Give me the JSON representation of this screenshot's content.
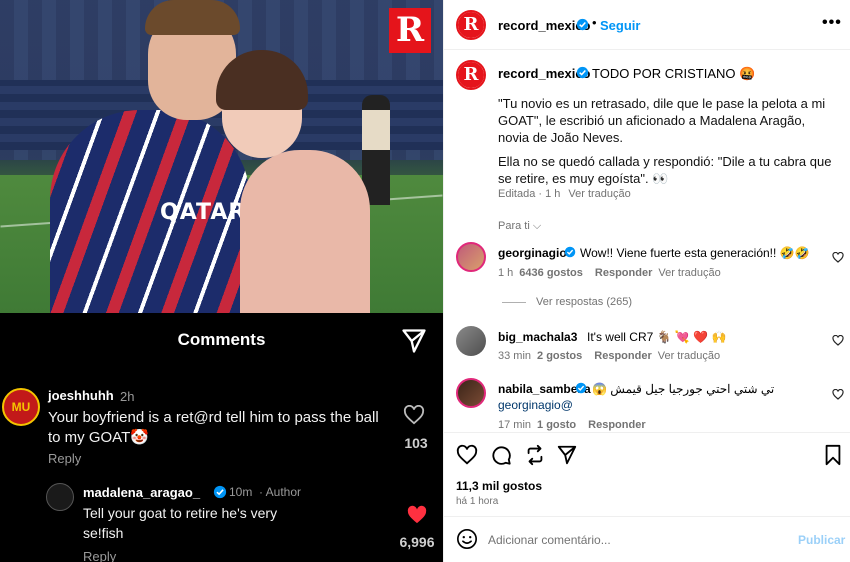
{
  "image": {
    "brand_badge": "R",
    "shirt_text": "QATAR"
  },
  "overlay": {
    "title": "Comments",
    "comment1": {
      "avatar_badge": "MU",
      "user": "joeshhuhh",
      "time": "2h",
      "text": "Your boyfriend is a ret@rd tell him to pass the ball to my GOAT🤡",
      "reply": "Reply",
      "likes": "103"
    },
    "comment2": {
      "user": "madalena_aragao_",
      "time": "10m",
      "author": "· Author",
      "text": "Tell your goat to retire he's very se!fish",
      "reply": "Reply",
      "likes": "6,996"
    }
  },
  "header": {
    "avatar": "R",
    "username": "record_mexico",
    "dot": "•",
    "follow": "Seguir",
    "more": "•••"
  },
  "caption": {
    "avatar": "R",
    "username": "record_mexico",
    "title": "TODO POR CRISTIANO 🤬",
    "p1": "\"Tu novio es un retrasado, dile que le pase la pelota a mi GOAT\", le escribió un aficionado a Madalena Aragão, novia de João Neves.",
    "p2": "Ella no se quedó callada y respondió: \"Dile a tu cabra que se retire, es muy egoísta\". 👀",
    "meta": "Editada · 1 h",
    "translate": "Ver tradução",
    "for_you": "Para ti ⌵"
  },
  "comments": [
    {
      "user": "georginagio",
      "text": "Wow!! Viene fuerte esta generación!! 🤣🤣",
      "time": "1 h",
      "likes": "6436 gostos",
      "reply": "Responder",
      "translate": "Ver tradução",
      "replies": "Ver respostas (265)"
    },
    {
      "user": "big_machala3",
      "text": "It's well CR7 🐐 💘 ❤️ 🙌",
      "time": "33 min",
      "likes": "2 gostos",
      "reply": "Responder",
      "translate": "Ver tradução"
    },
    {
      "user": "nabila_sambella",
      "text": "تي شتي احتي جورجيا جيل قيمش 😱",
      "mention": "georginagio@",
      "time": "17 min",
      "likes": "1 gosto",
      "reply": "Responder"
    }
  ],
  "footer": {
    "likes": "11,3 mil gostos",
    "age": "há 1 hora",
    "placeholder": "Adicionar comentário...",
    "publish": "Publicar"
  },
  "colors": {
    "brand_red": "#e5141b",
    "link_blue": "#0095f6",
    "verified_blue": "#0095f6",
    "like_red": "#ff3040"
  }
}
